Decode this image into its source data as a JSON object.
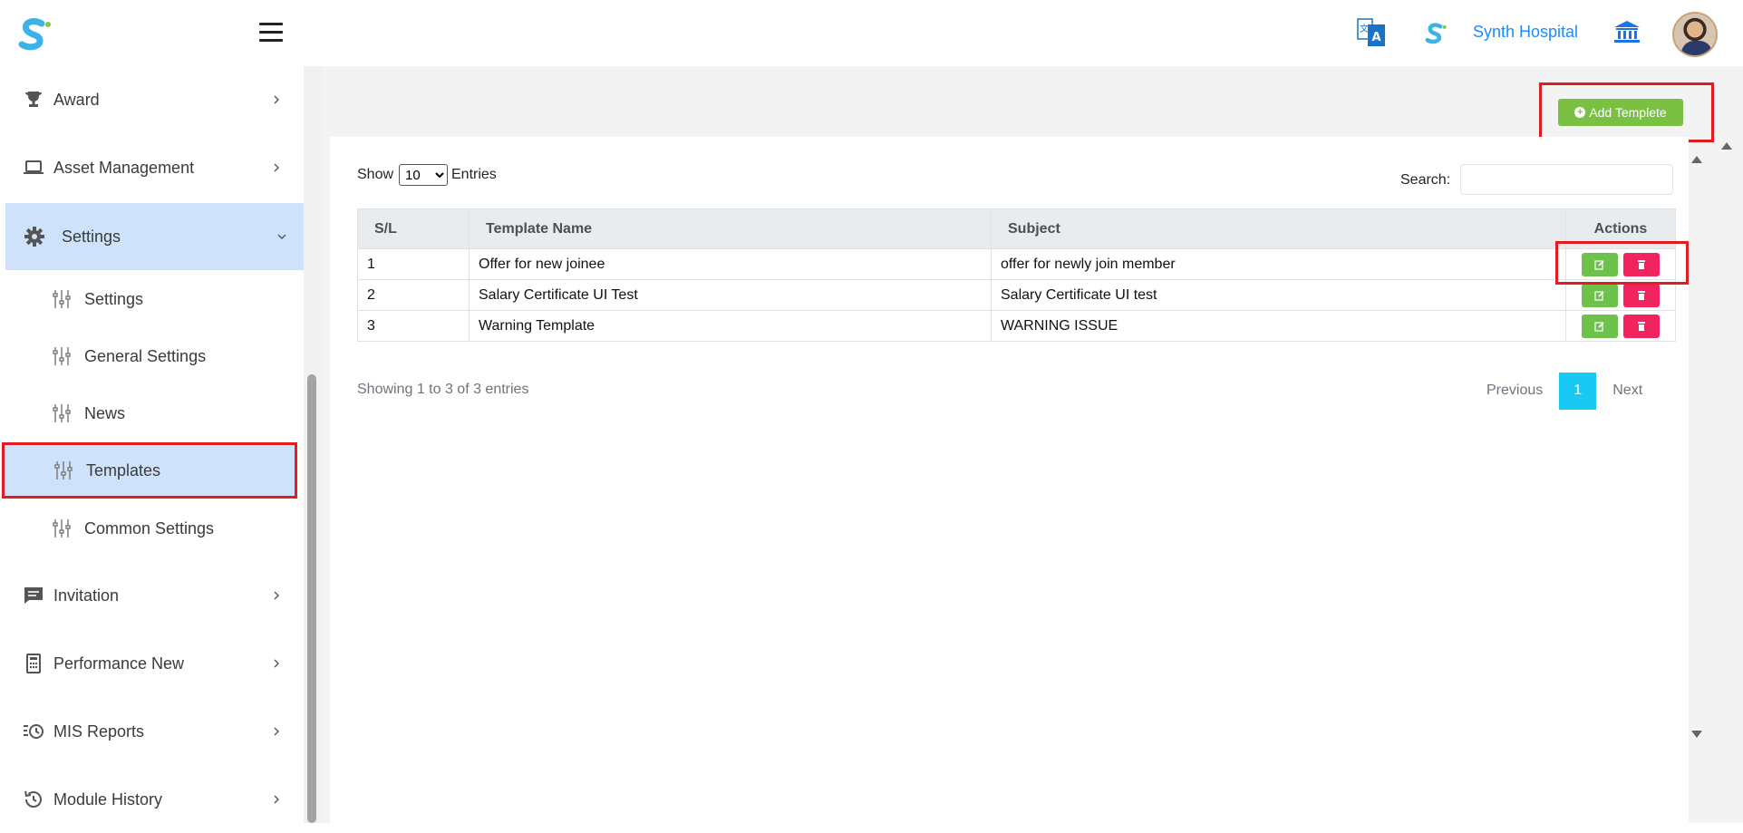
{
  "header": {
    "hospital_name": "Synth Hospital"
  },
  "sidebar": {
    "items": [
      {
        "label": "Award",
        "icon": "trophy-icon"
      },
      {
        "label": "Asset Management",
        "icon": "laptop-icon"
      },
      {
        "label": "Settings",
        "icon": "gear-icon"
      },
      {
        "label": "Invitation",
        "icon": "chat-icon"
      },
      {
        "label": "Performance New",
        "icon": "calculator-icon"
      },
      {
        "label": "MIS Reports",
        "icon": "clock-list-icon"
      },
      {
        "label": "Module History",
        "icon": "history-icon"
      }
    ],
    "sub_items": [
      {
        "label": "Settings"
      },
      {
        "label": "General Settings"
      },
      {
        "label": "News"
      },
      {
        "label": "Templates"
      },
      {
        "label": "Common Settings"
      }
    ]
  },
  "toolbar": {
    "add_label": "Add Templete"
  },
  "list_controls": {
    "show_label": "Show",
    "entries_label": "Entries",
    "page_size": "10",
    "page_size_options": [
      "10"
    ],
    "search_label": "Search:",
    "search_value": ""
  },
  "table": {
    "headers": [
      "S/L",
      "Template Name",
      "Subject",
      "Actions"
    ],
    "rows": [
      {
        "sl": "1",
        "name": "Offer for new joinee",
        "subject": "offer for newly join member"
      },
      {
        "sl": "2",
        "name": "Salary Certificate UI Test",
        "subject": "Salary Certificate UI test"
      },
      {
        "sl": "3",
        "name": "Warning Template",
        "subject": "WARNING ISSUE"
      }
    ]
  },
  "footer": {
    "showing": "Showing 1 to 3 of 3 entries",
    "prev": "Previous",
    "page": "1",
    "next": "Next"
  },
  "colors": {
    "accent": "#1a8cff",
    "add_button": "#7ac143",
    "edit_button": "#6cc24a",
    "delete_button": "#f0245e",
    "active_menu": "#cfe2fb",
    "pager_active": "#17c9f3",
    "highlight": "#e11d1d"
  }
}
